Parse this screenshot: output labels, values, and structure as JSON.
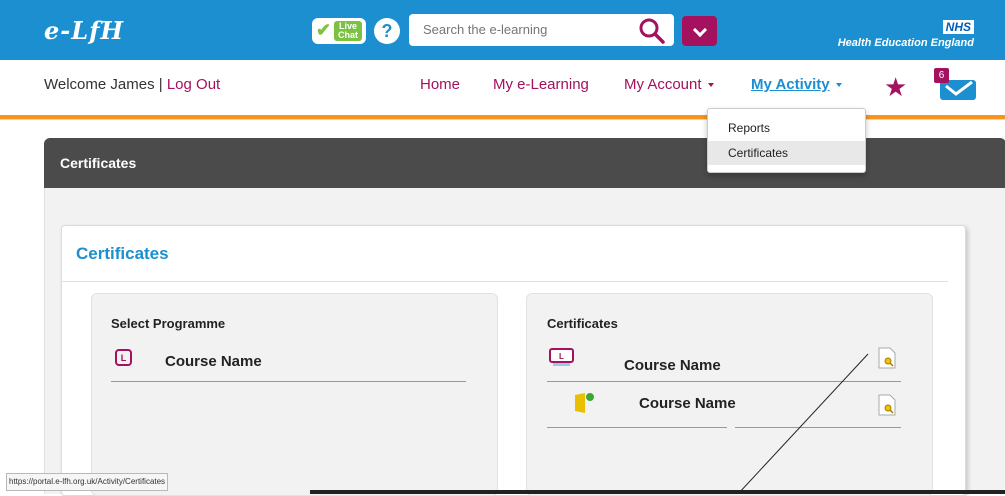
{
  "header": {
    "logo_text": "e-LfH",
    "live_chat": "Live Chat",
    "help": "?",
    "search_placeholder": "Search the e-learning",
    "nhs_badge": "NHS",
    "nhs_org": "Health Education England"
  },
  "user": {
    "welcome": "Welcome James | ",
    "logout": "Log Out"
  },
  "nav": {
    "home": "Home",
    "my_elearning": "My e-Learning",
    "my_account": "My Account",
    "my_activity": "My Activity",
    "messages_count": "6"
  },
  "dropdown": {
    "items": [
      "Reports",
      "Certificates"
    ]
  },
  "panel": {
    "title": "Certificates",
    "card_title": "Certificates"
  },
  "select_programme": {
    "title": "Select Programme",
    "items": [
      "Course Name"
    ]
  },
  "certificates": {
    "title": "Certificates",
    "items": [
      "Course Name",
      "Course Name"
    ]
  },
  "status_url": "https://portal.e-lfh.org.uk/Activity/Certificates",
  "colors": {
    "brand_blue": "#1b8fcf",
    "accent_purple": "#a3115f",
    "orange_rule": "#f7941d"
  }
}
